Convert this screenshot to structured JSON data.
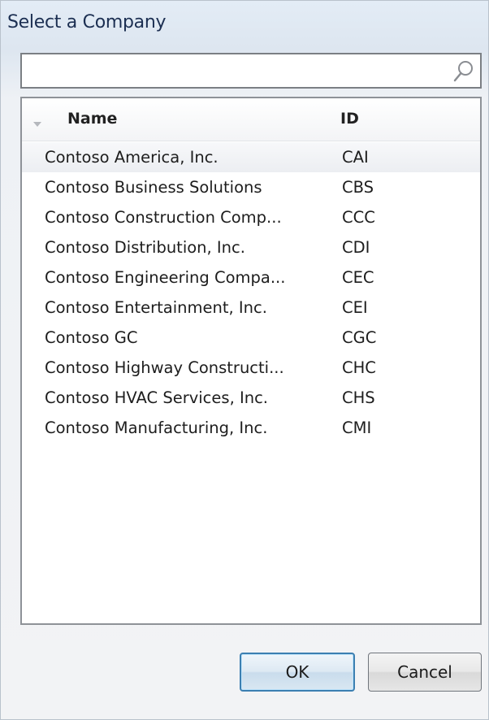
{
  "dialog": {
    "title": "Select a Company"
  },
  "search": {
    "value": "",
    "placeholder": "",
    "icon": "search-icon"
  },
  "list": {
    "sort_indicator": "sort-descending-icon",
    "columns": {
      "name": "Name",
      "id": "ID"
    },
    "rows": [
      {
        "name": "Contoso America, Inc.",
        "id": "CAI"
      },
      {
        "name": "Contoso Business Solutions",
        "id": "CBS"
      },
      {
        "name": "Contoso Construction Comp...",
        "id": "CCC"
      },
      {
        "name": "Contoso Distribution, Inc.",
        "id": "CDI"
      },
      {
        "name": "Contoso Engineering Compa...",
        "id": "CEC"
      },
      {
        "name": "Contoso Entertainment, Inc.",
        "id": "CEI"
      },
      {
        "name": "Contoso GC",
        "id": "CGC"
      },
      {
        "name": "Contoso Highway Constructi...",
        "id": "CHC"
      },
      {
        "name": "Contoso HVAC Services, Inc.",
        "id": "CHS"
      },
      {
        "name": "Contoso Manufacturing, Inc.",
        "id": "CMI"
      }
    ],
    "selected_index": 0
  },
  "buttons": {
    "ok": "OK",
    "cancel": "Cancel"
  },
  "colors": {
    "title_text": "#1c2f52",
    "ok_border": "#3c7fb1",
    "selected_row": "#eceef2"
  }
}
